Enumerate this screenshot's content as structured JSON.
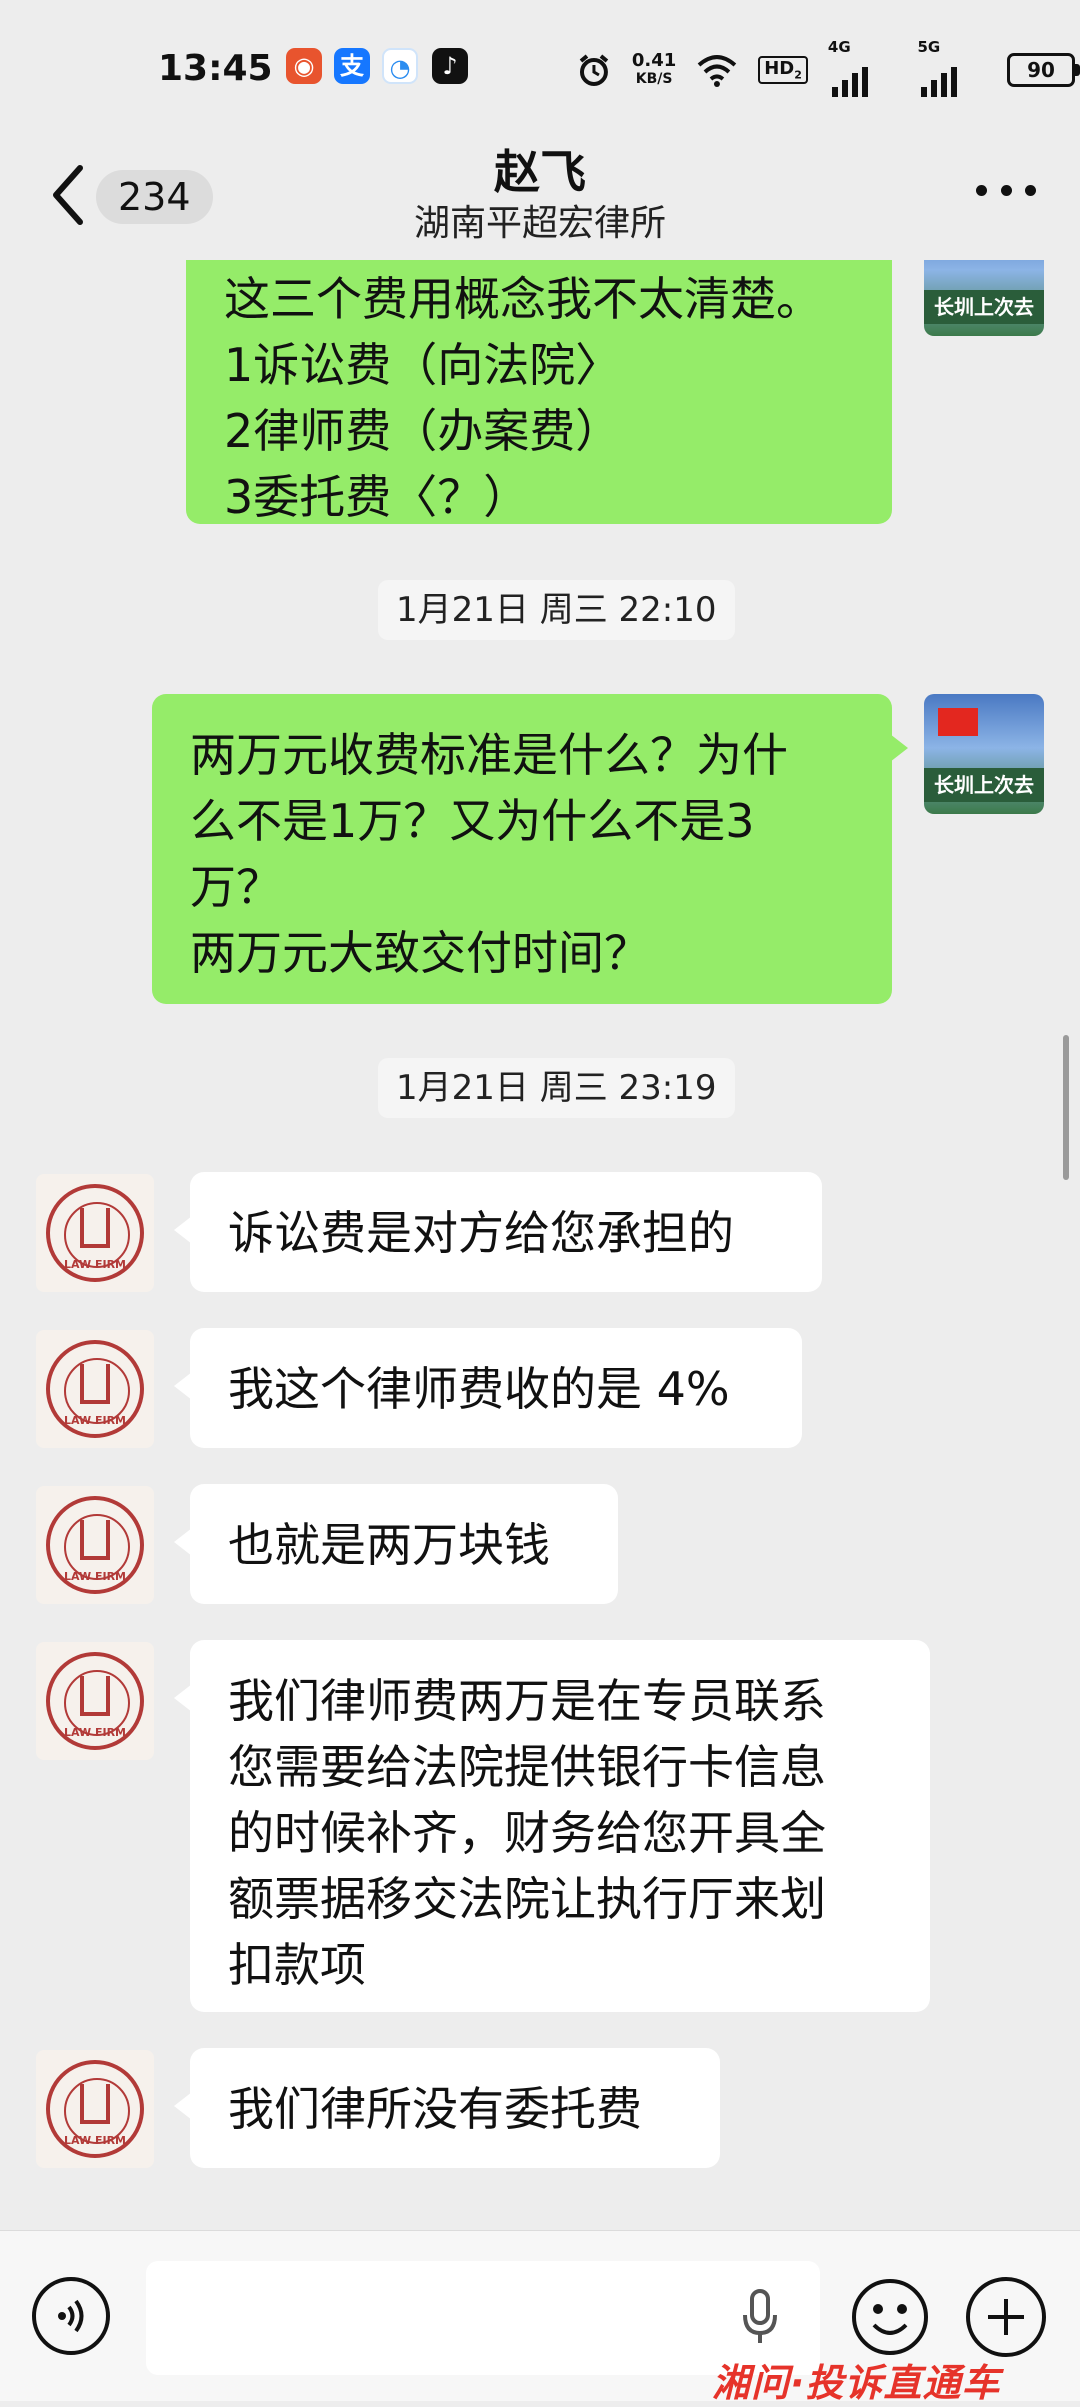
{
  "status_bar": {
    "time": "13:45",
    "net_speed_value": "0.41",
    "net_speed_unit": "KB/S",
    "hd_label": "HD",
    "hd_sub": "2",
    "sig1_label": "4G",
    "sig2_label": "5G",
    "battery": "90",
    "app_icons": [
      "weibo-icon",
      "alipay-icon",
      "browser-icon",
      "douyin-icon"
    ],
    "alarm_icon": "alarm-icon",
    "wifi_icon": "wifi-icon"
  },
  "header": {
    "back_icon": "chevron-left-icon",
    "unread_count": "234",
    "contact_name": "赵飞",
    "contact_company": "湖南平超宏律所",
    "more_icon": "more-dots-icon"
  },
  "messages": [
    {
      "side": "out",
      "text": "这三个费用概念我不太清楚。\n1诉讼费（向法院〉\n2律师费（办案费）\n3委托费〈？）"
    },
    {
      "type": "time",
      "text": "1月21日 周三 22:10"
    },
    {
      "side": "out",
      "text": "两万元收费标准是什么？为什\n么不是1万？又为什么不是3\n万？\n两万元大致交付时间？"
    },
    {
      "type": "time",
      "text": "1月21日 周三 23:19"
    },
    {
      "side": "in",
      "text": "诉讼费是对方给您承担的"
    },
    {
      "side": "in",
      "text": "我这个律师费收的是 4%"
    },
    {
      "side": "in",
      "text": "也就是两万块钱"
    },
    {
      "side": "in",
      "text": "我们律师费两万是在专员联系\n您需要给法院提供银行卡信息\n的时候补齐，财务给您开具全\n额票据移交法院让执行厅来划\n扣款项"
    },
    {
      "side": "in",
      "text": "我们律所没有委托费"
    }
  ],
  "avatars": {
    "me_band_text": "长圳上次去",
    "firm_text": "LAW FIRM"
  },
  "input_bar": {
    "voice_icon": "voice-mode-icon",
    "mic_icon": "microphone-icon",
    "emoji_icon": "emoji-icon",
    "plus_icon": "plus-icon"
  },
  "watermark": {
    "part1": "湘问",
    "separator": "·",
    "part2": "投诉直通车"
  },
  "colors": {
    "outgoing_bubble": "#95ec69",
    "incoming_bubble": "#ffffff",
    "background": "#ededed",
    "watermark": "#e6332a"
  }
}
